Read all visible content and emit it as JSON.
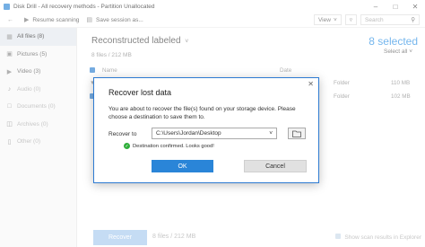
{
  "window": {
    "title": "Disk Drill - All recovery methods - Partition Unallocated"
  },
  "toolbar": {
    "back_icon": "arrow-left-icon",
    "resume_label": "Resume scanning",
    "save_label": "Save session as...",
    "view_label": "View",
    "search_placeholder": "Search"
  },
  "sidebar": {
    "items": [
      {
        "label": "All files (8)",
        "icon": "grid-icon"
      },
      {
        "label": "Pictures (5)",
        "icon": "image-icon"
      },
      {
        "label": "Video (3)",
        "icon": "video-icon"
      },
      {
        "label": "Audio (0)",
        "icon": "music-icon"
      },
      {
        "label": "Documents (0)",
        "icon": "document-icon"
      },
      {
        "label": "Archives (0)",
        "icon": "archive-icon"
      },
      {
        "label": "Other (0)",
        "icon": "file-icon"
      }
    ]
  },
  "main": {
    "heading": "Reconstructed labeled",
    "subhead": "8 files / 212 MB",
    "selected": "8 selected",
    "select_all": "Select all",
    "columns": {
      "name": "Name",
      "date": "Date"
    },
    "rows": [
      {
        "kind": "Folder",
        "size": "110 MB"
      },
      {
        "kind": "Folder",
        "size": "102 MB"
      }
    ]
  },
  "footer": {
    "recover": "Recover",
    "info": "8 files / 212 MB",
    "show_explorer": "Show scan results in Explorer"
  },
  "dialog": {
    "title": "Recover lost data",
    "description": "You are about to recover the file(s) found on your storage device. Please choose a destination to save them to.",
    "recover_to_label": "Recover to",
    "path": "C:\\Users\\Jordan\\Desktop",
    "confirmation": "Destination confirmed. Looks good!",
    "ok": "OK",
    "cancel": "Cancel"
  },
  "colors": {
    "accent": "#2b8fe3",
    "ok_button": "#2a85d8",
    "success": "#2fae3b"
  }
}
